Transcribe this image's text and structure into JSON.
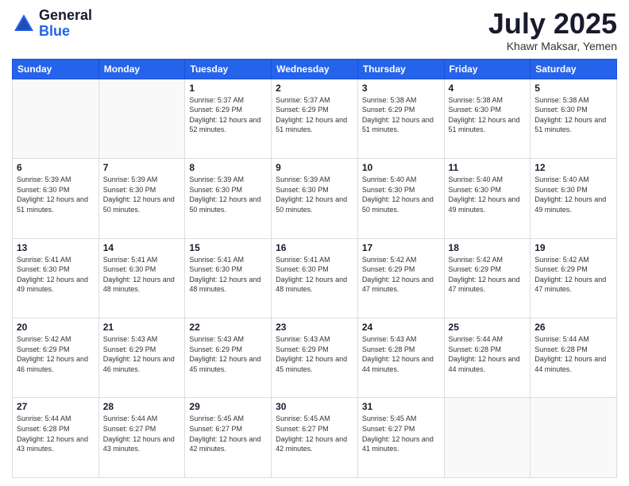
{
  "logo": {
    "general": "General",
    "blue": "Blue"
  },
  "header": {
    "month": "July 2025",
    "location": "Khawr Maksar, Yemen"
  },
  "weekdays": [
    "Sunday",
    "Monday",
    "Tuesday",
    "Wednesday",
    "Thursday",
    "Friday",
    "Saturday"
  ],
  "weeks": [
    [
      {
        "day": "",
        "info": ""
      },
      {
        "day": "",
        "info": ""
      },
      {
        "day": "1",
        "info": "Sunrise: 5:37 AM\nSunset: 6:29 PM\nDaylight: 12 hours and 52 minutes."
      },
      {
        "day": "2",
        "info": "Sunrise: 5:37 AM\nSunset: 6:29 PM\nDaylight: 12 hours and 51 minutes."
      },
      {
        "day": "3",
        "info": "Sunrise: 5:38 AM\nSunset: 6:29 PM\nDaylight: 12 hours and 51 minutes."
      },
      {
        "day": "4",
        "info": "Sunrise: 5:38 AM\nSunset: 6:30 PM\nDaylight: 12 hours and 51 minutes."
      },
      {
        "day": "5",
        "info": "Sunrise: 5:38 AM\nSunset: 6:30 PM\nDaylight: 12 hours and 51 minutes."
      }
    ],
    [
      {
        "day": "6",
        "info": "Sunrise: 5:39 AM\nSunset: 6:30 PM\nDaylight: 12 hours and 51 minutes."
      },
      {
        "day": "7",
        "info": "Sunrise: 5:39 AM\nSunset: 6:30 PM\nDaylight: 12 hours and 50 minutes."
      },
      {
        "day": "8",
        "info": "Sunrise: 5:39 AM\nSunset: 6:30 PM\nDaylight: 12 hours and 50 minutes."
      },
      {
        "day": "9",
        "info": "Sunrise: 5:39 AM\nSunset: 6:30 PM\nDaylight: 12 hours and 50 minutes."
      },
      {
        "day": "10",
        "info": "Sunrise: 5:40 AM\nSunset: 6:30 PM\nDaylight: 12 hours and 50 minutes."
      },
      {
        "day": "11",
        "info": "Sunrise: 5:40 AM\nSunset: 6:30 PM\nDaylight: 12 hours and 49 minutes."
      },
      {
        "day": "12",
        "info": "Sunrise: 5:40 AM\nSunset: 6:30 PM\nDaylight: 12 hours and 49 minutes."
      }
    ],
    [
      {
        "day": "13",
        "info": "Sunrise: 5:41 AM\nSunset: 6:30 PM\nDaylight: 12 hours and 49 minutes."
      },
      {
        "day": "14",
        "info": "Sunrise: 5:41 AM\nSunset: 6:30 PM\nDaylight: 12 hours and 48 minutes."
      },
      {
        "day": "15",
        "info": "Sunrise: 5:41 AM\nSunset: 6:30 PM\nDaylight: 12 hours and 48 minutes."
      },
      {
        "day": "16",
        "info": "Sunrise: 5:41 AM\nSunset: 6:30 PM\nDaylight: 12 hours and 48 minutes."
      },
      {
        "day": "17",
        "info": "Sunrise: 5:42 AM\nSunset: 6:29 PM\nDaylight: 12 hours and 47 minutes."
      },
      {
        "day": "18",
        "info": "Sunrise: 5:42 AM\nSunset: 6:29 PM\nDaylight: 12 hours and 47 minutes."
      },
      {
        "day": "19",
        "info": "Sunrise: 5:42 AM\nSunset: 6:29 PM\nDaylight: 12 hours and 47 minutes."
      }
    ],
    [
      {
        "day": "20",
        "info": "Sunrise: 5:42 AM\nSunset: 6:29 PM\nDaylight: 12 hours and 46 minutes."
      },
      {
        "day": "21",
        "info": "Sunrise: 5:43 AM\nSunset: 6:29 PM\nDaylight: 12 hours and 46 minutes."
      },
      {
        "day": "22",
        "info": "Sunrise: 5:43 AM\nSunset: 6:29 PM\nDaylight: 12 hours and 45 minutes."
      },
      {
        "day": "23",
        "info": "Sunrise: 5:43 AM\nSunset: 6:29 PM\nDaylight: 12 hours and 45 minutes."
      },
      {
        "day": "24",
        "info": "Sunrise: 5:43 AM\nSunset: 6:28 PM\nDaylight: 12 hours and 44 minutes."
      },
      {
        "day": "25",
        "info": "Sunrise: 5:44 AM\nSunset: 6:28 PM\nDaylight: 12 hours and 44 minutes."
      },
      {
        "day": "26",
        "info": "Sunrise: 5:44 AM\nSunset: 6:28 PM\nDaylight: 12 hours and 44 minutes."
      }
    ],
    [
      {
        "day": "27",
        "info": "Sunrise: 5:44 AM\nSunset: 6:28 PM\nDaylight: 12 hours and 43 minutes."
      },
      {
        "day": "28",
        "info": "Sunrise: 5:44 AM\nSunset: 6:27 PM\nDaylight: 12 hours and 43 minutes."
      },
      {
        "day": "29",
        "info": "Sunrise: 5:45 AM\nSunset: 6:27 PM\nDaylight: 12 hours and 42 minutes."
      },
      {
        "day": "30",
        "info": "Sunrise: 5:45 AM\nSunset: 6:27 PM\nDaylight: 12 hours and 42 minutes."
      },
      {
        "day": "31",
        "info": "Sunrise: 5:45 AM\nSunset: 6:27 PM\nDaylight: 12 hours and 41 minutes."
      },
      {
        "day": "",
        "info": ""
      },
      {
        "day": "",
        "info": ""
      }
    ]
  ]
}
